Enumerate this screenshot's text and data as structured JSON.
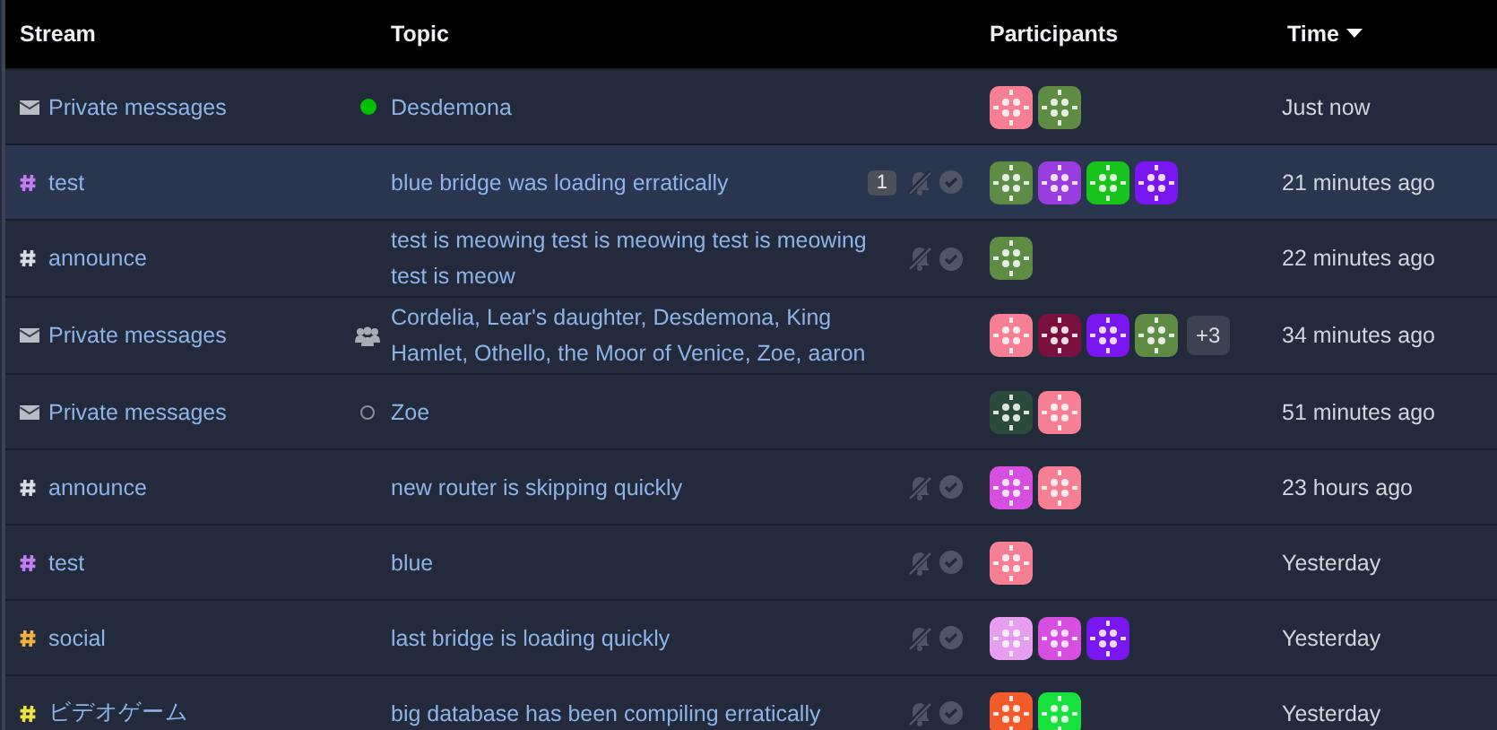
{
  "columns": [
    {
      "label": "Stream",
      "sorted": false
    },
    {
      "label": "Topic",
      "sorted": false
    },
    {
      "label": "Participants",
      "sorted": false
    },
    {
      "label": "Time",
      "sorted": true
    }
  ],
  "rows": [
    {
      "kind": "private",
      "stream": "Private messages",
      "presence": {
        "kind": "active"
      },
      "topic": "Desdemona",
      "highlighted": false,
      "participants": [
        {
          "color": "#f77f94"
        },
        {
          "color": "#5e8c45"
        }
      ],
      "time": "Just now"
    },
    {
      "kind": "stream",
      "color": "#c37cf2",
      "stream": "test",
      "topic": "blue bridge was loading erratically",
      "unread": "1",
      "actions": true,
      "highlighted": true,
      "participants": [
        {
          "color": "#5e8c45"
        },
        {
          "color": "#9a3de0"
        },
        {
          "color": "#18c41c"
        },
        {
          "color": "#7a16f0"
        }
      ],
      "time": "21 minutes ago"
    },
    {
      "kind": "stream",
      "color": "#d6dbe4",
      "stream": "announce",
      "topic": "test is meowing test is meowing test is meowing test is meow",
      "actions": true,
      "highlighted": false,
      "participants": [
        {
          "color": "#5e8c45"
        }
      ],
      "time": "22 minutes ago"
    },
    {
      "kind": "private",
      "stream": "Private messages",
      "presence": {
        "kind": "group"
      },
      "topic": "Cordelia, Lear's daughter, Desdemona, King Hamlet, Othello, the Moor of Venice, Zoe, aaron",
      "highlighted": false,
      "participants": [
        {
          "color": "#f77f94"
        },
        {
          "color": "#7a1040"
        },
        {
          "color": "#7a16f0"
        },
        {
          "color": "#5e8c45"
        }
      ],
      "more": "+3",
      "time": "34 minutes ago"
    },
    {
      "kind": "private",
      "stream": "Private messages",
      "presence": {
        "kind": "offline"
      },
      "topic": "Zoe",
      "highlighted": false,
      "participants": [
        {
          "color": "#2c4a3c"
        },
        {
          "color": "#f77f94"
        }
      ],
      "time": "51 minutes ago"
    },
    {
      "kind": "stream",
      "color": "#d6dbe4",
      "stream": "announce",
      "topic": "new router is skipping quickly",
      "actions": true,
      "highlighted": false,
      "participants": [
        {
          "color": "#d64fe0"
        },
        {
          "color": "#f77f94"
        }
      ],
      "time": "23 hours ago"
    },
    {
      "kind": "stream",
      "color": "#c37cf2",
      "stream": "test",
      "topic": "blue",
      "actions": true,
      "highlighted": false,
      "participants": [
        {
          "color": "#f77f94"
        }
      ],
      "time": "Yesterday"
    },
    {
      "kind": "stream",
      "color": "#f2b43c",
      "stream": "social",
      "topic": "last bridge is loading quickly",
      "actions": true,
      "highlighted": false,
      "participants": [
        {
          "color": "#e79ef0"
        },
        {
          "color": "#d64fe0"
        },
        {
          "color": "#7a16f0"
        }
      ],
      "time": "Yesterday"
    },
    {
      "kind": "stream",
      "color": "#f2e13c",
      "stream": "ビデオゲーム",
      "topic": "big database has been compiling erratically",
      "actions": true,
      "highlighted": false,
      "participants": [
        {
          "color": "#f25a2c"
        },
        {
          "color": "#18e03c"
        }
      ],
      "time": "Yesterday"
    }
  ]
}
